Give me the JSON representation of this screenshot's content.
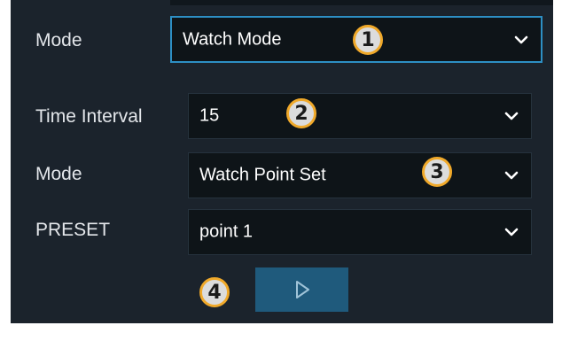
{
  "form": {
    "mode_label": "Mode",
    "mode_value": "Watch Mode",
    "time_interval_label": "Time Interval",
    "time_interval_value": "15",
    "mode2_label": "Mode",
    "mode2_value": "Watch Point Set",
    "preset_label": "PRESET",
    "preset_value": "point 1"
  },
  "badges": [
    "1",
    "2",
    "3",
    "4"
  ],
  "icons": {
    "dropdown": "chevron-down-icon",
    "play": "play-icon"
  },
  "colors": {
    "panel_bg": "#1b232c",
    "field_bg": "#0e1418",
    "accent_border": "#2d8fc4",
    "play_button": "#1f5a7c",
    "badge_border": "#f0a92a"
  }
}
